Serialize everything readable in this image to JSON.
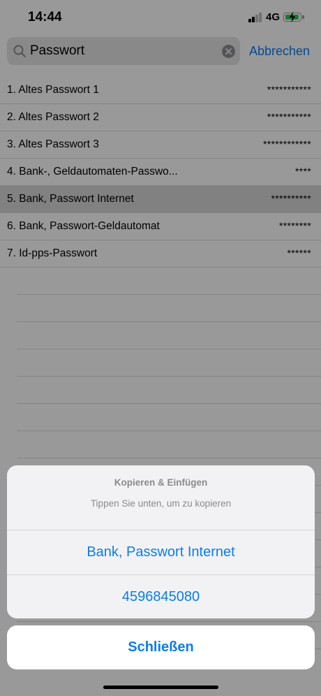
{
  "status_bar": {
    "time": "14:44",
    "network": "4G",
    "battery_color": "#34c759"
  },
  "search": {
    "query": "Passwort",
    "cancel_label": "Abbrechen",
    "icon": "search-icon",
    "clear_icon": "clear-icon"
  },
  "list": {
    "items": [
      {
        "label": "1. Altes Passwort 1",
        "value": "***********"
      },
      {
        "label": "2. Altes Passwort 2",
        "value": "***********"
      },
      {
        "label": "3. Altes Passwort 3",
        "value": "************"
      },
      {
        "label": "4. Bank-, Geldautomaten-Passwo...",
        "value": "****"
      },
      {
        "label": "5. Bank, Passwort Internet",
        "value": "**********"
      },
      {
        "label": "6. Bank, Passwort-Geldautomat",
        "value": "********"
      },
      {
        "label": "7. Id-pps-Passwort",
        "value": "******"
      }
    ],
    "selected_index": 4
  },
  "action_sheet": {
    "title": "Kopieren & Einfügen",
    "message": "Tippen Sie unten, um zu kopieren",
    "actions": [
      {
        "label": "Bank, Passwort Internet"
      },
      {
        "label": "4596845080"
      }
    ],
    "close_label": "Schließen"
  },
  "colors": {
    "accent": "#0a7cf0"
  }
}
